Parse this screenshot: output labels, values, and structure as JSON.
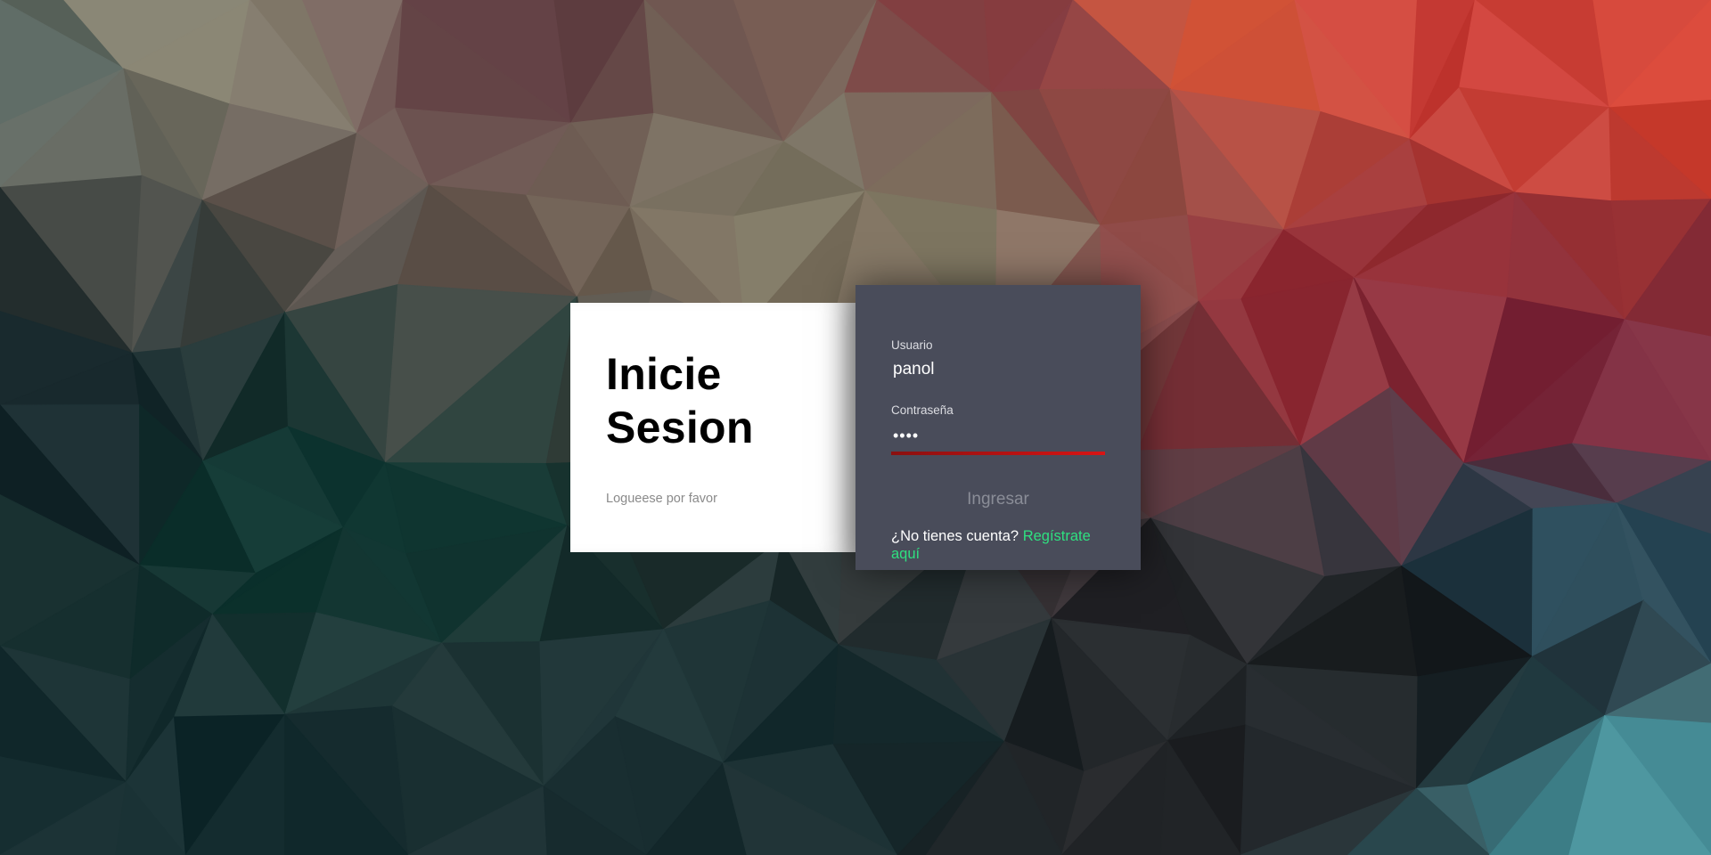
{
  "colors": {
    "card_left_bg": "#ffffff",
    "card_right_bg": "#494c5a",
    "link": "#2fe080",
    "error_underline": "#d81414",
    "button_text": "#8a8d97"
  },
  "intro": {
    "title": "Inicie Sesion",
    "subtitle": "Logueese por favor"
  },
  "form": {
    "username_label": "Usuario",
    "username_value": "panol",
    "password_label": "Contraseña",
    "password_value": "••••",
    "submit_label": "Ingresar",
    "register_prompt": "¿No tienes cuenta?",
    "register_link": "Regístrate aquí"
  }
}
